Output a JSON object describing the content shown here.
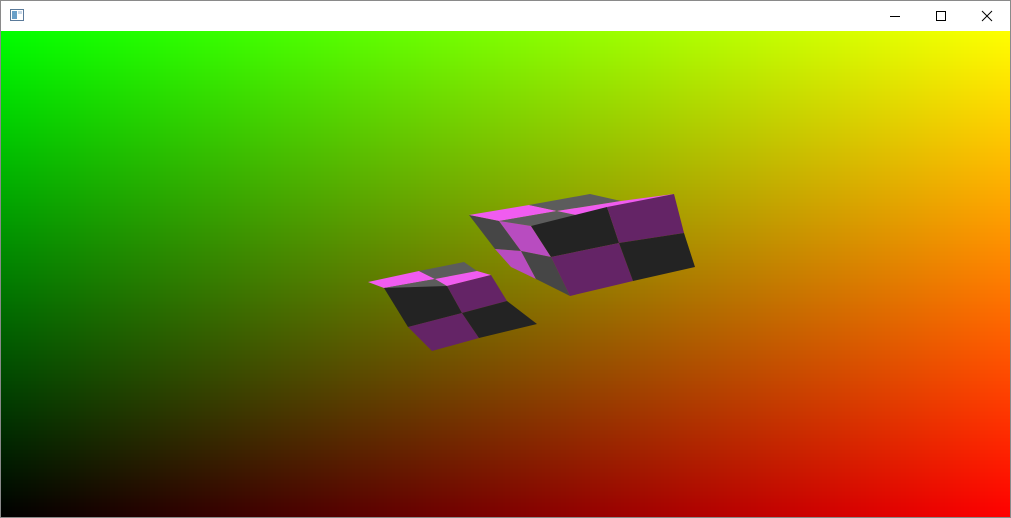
{
  "window": {
    "title": "",
    "caption_buttons": {
      "minimize_icon": "minimize-icon",
      "maximize_icon": "maximize-icon",
      "close_icon": "close-icon"
    }
  },
  "viewport": {
    "background_gradient": {
      "top_left": "#00ff00",
      "top_right": "#ffff00",
      "bottom_left": "#000000",
      "bottom_right": "#ff0000"
    },
    "checker_colors": {
      "magenta_light": "#f05cf0",
      "magenta_mid": "#b84cc0",
      "purple_dark": "#642466",
      "grey_dark": "#232323",
      "grey_mid": "#464646",
      "grey_light": "#5c5c5c"
    },
    "objects": [
      {
        "name": "cube-left"
      },
      {
        "name": "cube-right"
      }
    ]
  }
}
